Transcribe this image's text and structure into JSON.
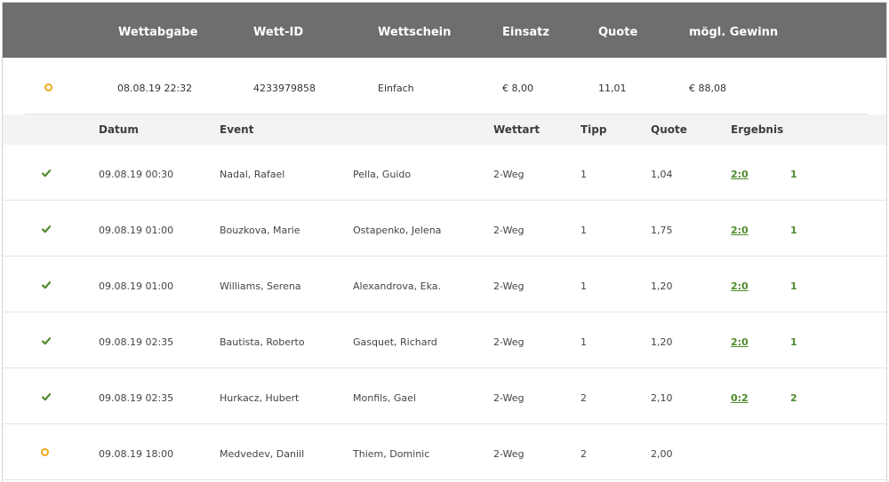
{
  "header": {
    "wettabgabe": "Wettabgabe",
    "wett_id": "Wett-ID",
    "wettschein": "Wettschein",
    "einsatz": "Einsatz",
    "quote": "Quote",
    "gewinn": "mögl. Gewinn"
  },
  "summary": {
    "status_icon": "pending-circle-icon",
    "date": "08.08.19 22:32",
    "id": "4233979858",
    "type": "Einfach",
    "stake": "€ 8,00",
    "odds": "11,01",
    "win": "€ 88,08"
  },
  "columns": {
    "datum": "Datum",
    "event": "Event",
    "wettart": "Wettart",
    "tipp": "Tipp",
    "quote": "Quote",
    "ergebnis": "Ergebnis"
  },
  "rows": [
    {
      "status": "won",
      "date": "09.08.19 00:30",
      "home": "Nadal, Rafael",
      "away": "Pella, Guido",
      "type": "2-Weg",
      "tip": "1",
      "odds": "1,04",
      "score": "2:0",
      "outcome": "1"
    },
    {
      "status": "won",
      "date": "09.08.19 01:00",
      "home": "Bouzkova, Marie",
      "away": "Ostapenko, Jelena",
      "type": "2-Weg",
      "tip": "1",
      "odds": "1,75",
      "score": "2:0",
      "outcome": "1"
    },
    {
      "status": "won",
      "date": "09.08.19 01:00",
      "home": "Williams, Serena",
      "away": "Alexandrova, Eka.",
      "type": "2-Weg",
      "tip": "1",
      "odds": "1,20",
      "score": "2:0",
      "outcome": "1"
    },
    {
      "status": "won",
      "date": "09.08.19 02:35",
      "home": "Bautista, Roberto",
      "away": "Gasquet, Richard",
      "type": "2-Weg",
      "tip": "1",
      "odds": "1,20",
      "score": "2:0",
      "outcome": "1"
    },
    {
      "status": "won",
      "date": "09.08.19 02:35",
      "home": "Hurkacz, Hubert",
      "away": "Monfils, Gael",
      "type": "2-Weg",
      "tip": "2",
      "odds": "2,10",
      "score": "0:2",
      "outcome": "2"
    },
    {
      "status": "pending",
      "date": "09.08.19 18:00",
      "home": "Medvedev, Daniil",
      "away": "Thiem, Dominic",
      "type": "2-Weg",
      "tip": "2",
      "odds": "2,00",
      "score": "",
      "outcome": ""
    }
  ],
  "colors": {
    "header_bg": "#6e6e6e",
    "won_green": "#4e8a2b",
    "pending_orange": "#f0a818",
    "subheader_bg": "#f3f3f3"
  }
}
